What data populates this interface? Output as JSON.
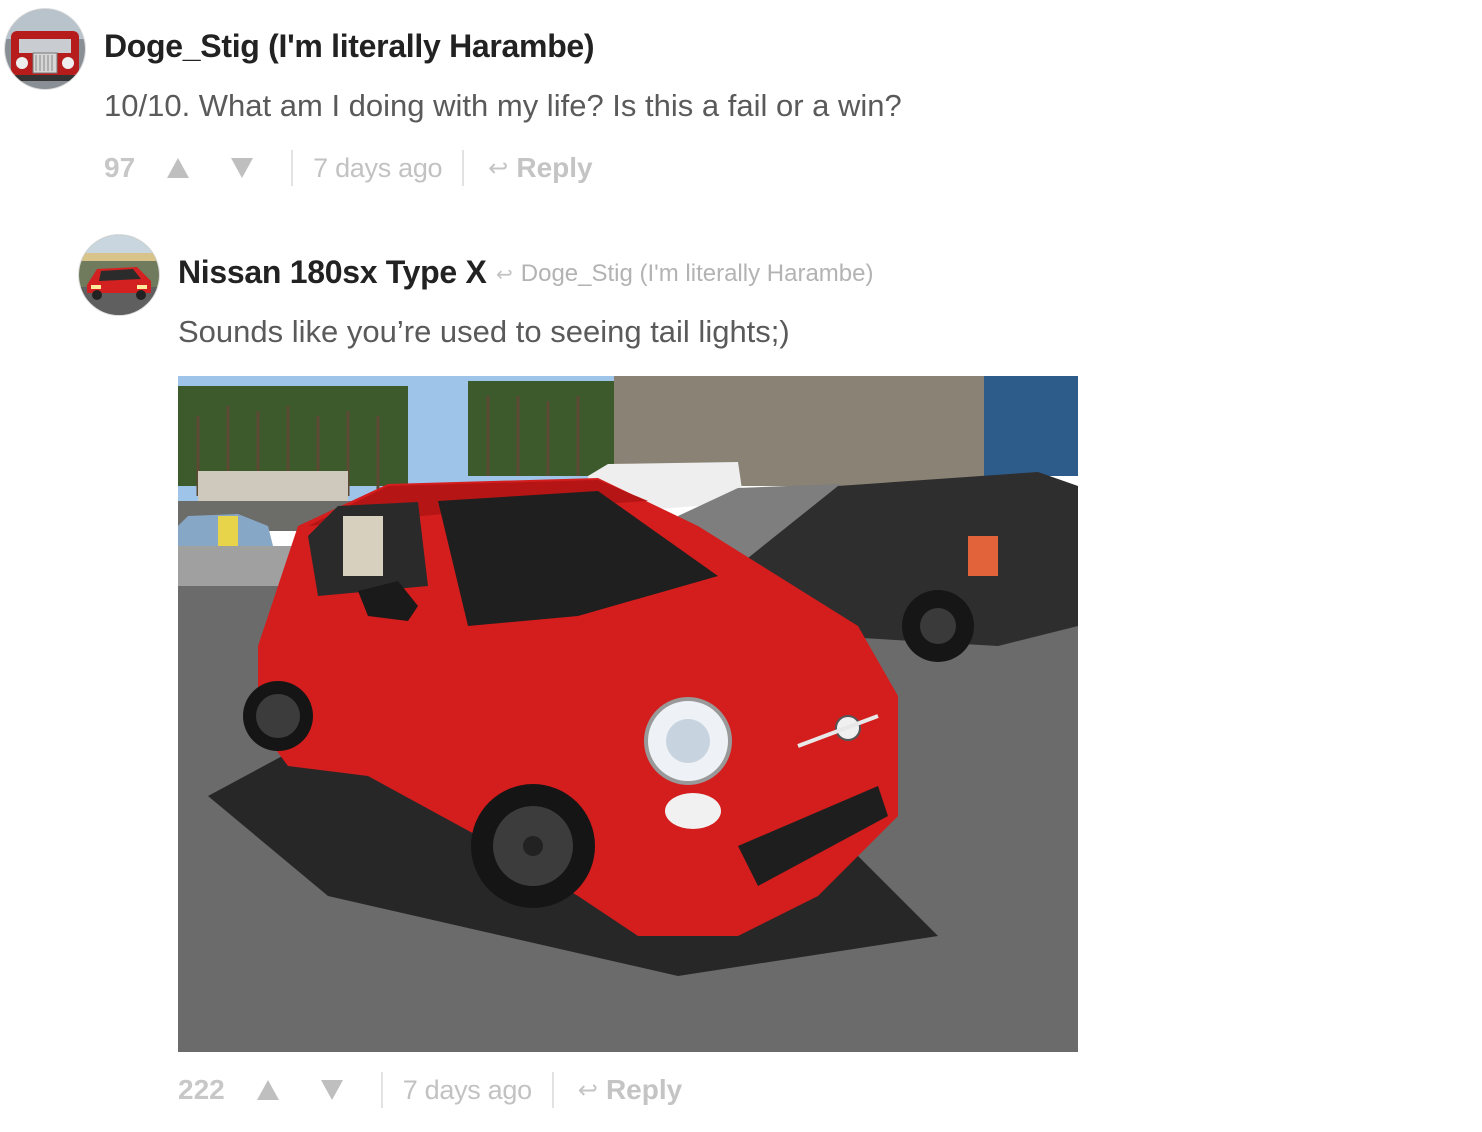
{
  "comments": [
    {
      "author": "Doge_Stig (I'm literally Harambe)",
      "avatar_icon": "red-classic-car-avatar",
      "text": "10/10. What am I doing with my life? Is this a fail or a win?",
      "votes": "97",
      "time": "7 days ago",
      "reply_label": "Reply"
    },
    {
      "author": "Nissan 180sx Type X",
      "avatar_icon": "red-sports-car-avatar",
      "reply_to": "Doge_Stig (I'm literally Harambe)",
      "text": "Sounds like you’re used to seeing tail lights;)",
      "image_icon": "red-fiat-500-abarth-photo",
      "votes": "222",
      "time": "7 days ago",
      "reply_label": "Reply"
    }
  ],
  "colors": {
    "author": "#222222",
    "body": "#5a5a5a",
    "muted": "#bdbdbd",
    "car_red": "#d41d1d"
  }
}
